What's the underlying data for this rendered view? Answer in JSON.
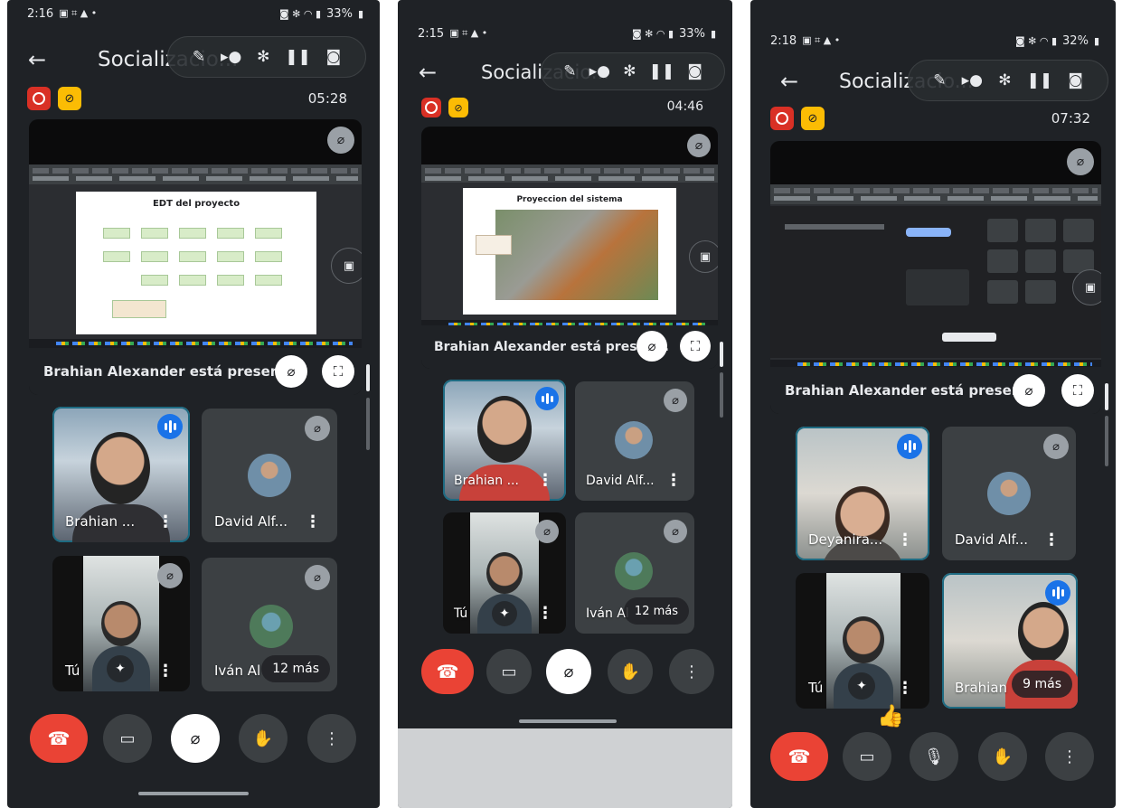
{
  "colors": {
    "hangup": "#ea4335",
    "record": "#d93025",
    "camera_off_badge": "#fbbc04",
    "speaking": "#1a73e8",
    "surface": "#1f2226"
  },
  "phones": [
    {
      "status": {
        "time": "2:16",
        "battery": "33%"
      },
      "title": "Socializacio...",
      "timer": "05:28",
      "slide_title": "EDT del proyecto",
      "presenting_label": "Brahian Alexander está presen...",
      "tiles": [
        {
          "name": "Brahian ...",
          "state": "speaking"
        },
        {
          "name": "David Alf...",
          "state": "muted"
        },
        {
          "name": "Tú",
          "state": "muted"
        },
        {
          "name": "Iván Al",
          "state": "muted",
          "more": "12 más"
        }
      ],
      "controls": {
        "mic": "muted"
      }
    },
    {
      "status": {
        "time": "2:15",
        "battery": "33%"
      },
      "title": "Socializacio...",
      "timer": "04:46",
      "slide_title": "Proyeccion del sistema",
      "presenting_label": "Brahian Alexander está presen...",
      "tiles": [
        {
          "name": "Brahian ...",
          "state": "speaking"
        },
        {
          "name": "David Alf...",
          "state": "muted"
        },
        {
          "name": "Tú",
          "state": "muted"
        },
        {
          "name": "Iván Al",
          "state": "muted",
          "more": "12 más"
        }
      ],
      "controls": {
        "mic": "muted"
      }
    },
    {
      "status": {
        "time": "2:18",
        "battery": "32%"
      },
      "title": "Socializacio...",
      "timer": "07:32",
      "slide_title": "",
      "presenting_label": "Brahian Alexander está presen...",
      "tiles": [
        {
          "name": "Deyanira...",
          "state": "speaking"
        },
        {
          "name": "David Alf...",
          "state": "muted"
        },
        {
          "name": "Tú",
          "state": "none"
        },
        {
          "name": "Brahian",
          "state": "speaking",
          "more": "9 más"
        }
      ],
      "controls": {
        "mic": "on"
      }
    }
  ],
  "icons": {
    "back": "back-arrow-icon",
    "mic_off": "mic-off-icon",
    "mic": "mic-icon",
    "camera": "camera-icon",
    "hand": "raise-hand-icon",
    "more": "more-vert-icon",
    "end_call": "end-call-icon",
    "fullscreen": "fullscreen-icon",
    "sparkle": "effects-sparkle-icon",
    "switch_camera": "switch-camera-icon"
  }
}
